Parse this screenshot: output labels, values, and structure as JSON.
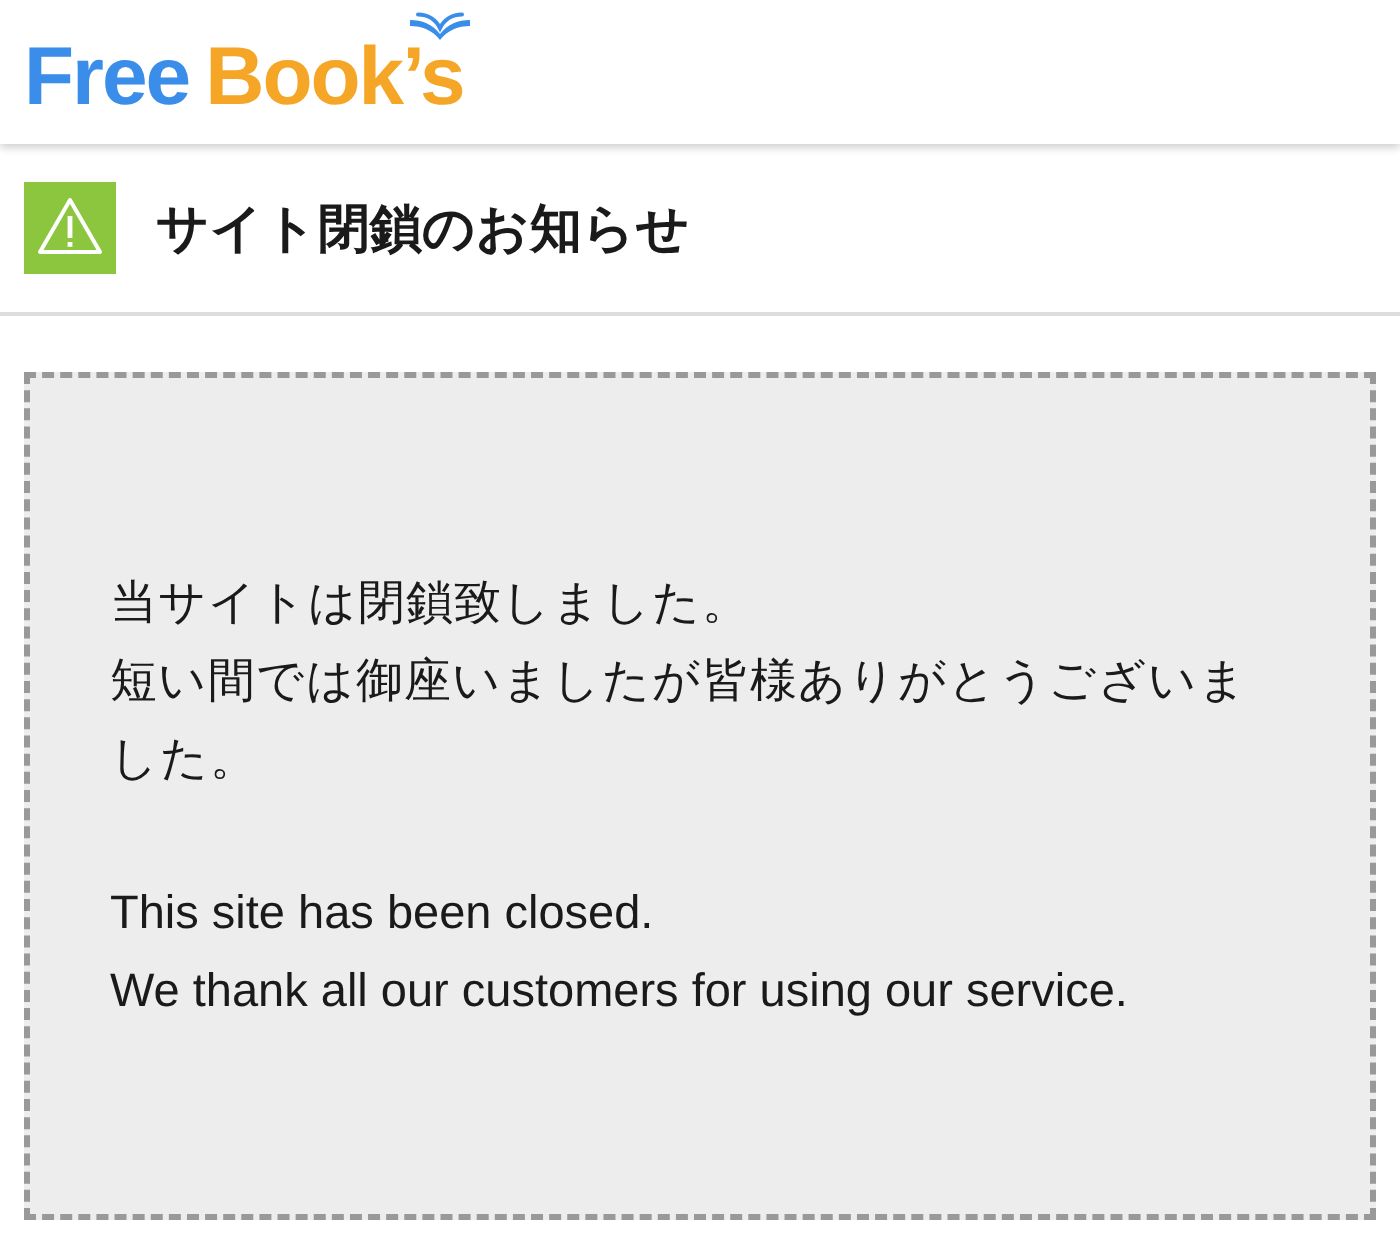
{
  "header": {
    "logo": [
      {
        "text": "Free",
        "color": "#3a8de9"
      },
      {
        "text": "Book’s",
        "color": "#f5a627"
      }
    ]
  },
  "notice": {
    "title": "サイト閉鎖のお知らせ"
  },
  "message": {
    "paragraphs": [
      [
        "当サイトは閉鎖致しました。",
        "短い間では御座いましたが皆様ありがとうございました。"
      ],
      [
        "This site has been closed.",
        "We thank all our customers for using our service."
      ]
    ]
  }
}
